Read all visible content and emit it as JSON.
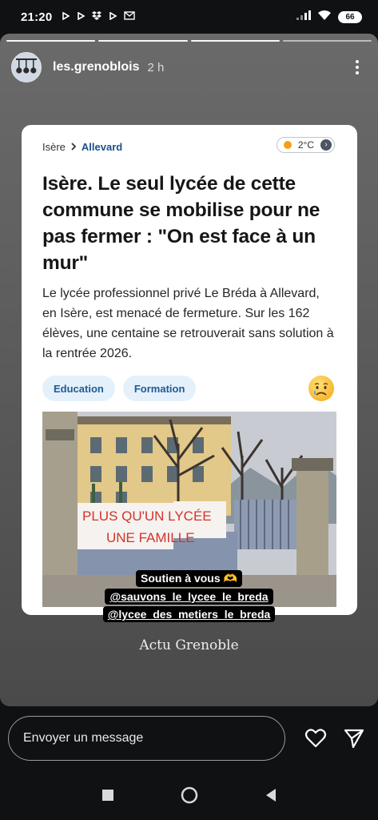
{
  "status_bar": {
    "time": "21:20",
    "battery": "66"
  },
  "story": {
    "username": "les.grenoblois",
    "time_ago": "2 h",
    "progress_segments": 4,
    "active_segment": 3
  },
  "article": {
    "breadcrumb_region": "Isère",
    "breadcrumb_city": "Allevard",
    "weather_temp": "2°C",
    "headline": "Isère. Le seul lycée de cette commune se mobilise pour ne pas fermer : \"On est face à un mur\"",
    "lede": "Le lycée professionnel privé Le Bréda à Allevard, en Isère, est menacé de fermeture. Sur les 162 élèves, une centaine se retrouverait sans solution à la rentrée 2026.",
    "tags": [
      "Education",
      "Formation"
    ],
    "reaction_icon": "sad-face-emoji-icon",
    "banner_line1": "PLUS QU'UN LYCÉE",
    "banner_line2": "UNE FAMILLE"
  },
  "stickers": {
    "line1": "Soutien à vous 🫶",
    "line2": "@sauvons_le_lycee_le_breda",
    "line3": "@lycee_des_metiers_le_breda"
  },
  "caption": "Actu Grenoble",
  "reply": {
    "placeholder": "Envoyer un message"
  },
  "colors": {
    "tag_bg": "#e4f1fb",
    "tag_text": "#1f5b91",
    "link_blue": "#1e4f8c"
  }
}
